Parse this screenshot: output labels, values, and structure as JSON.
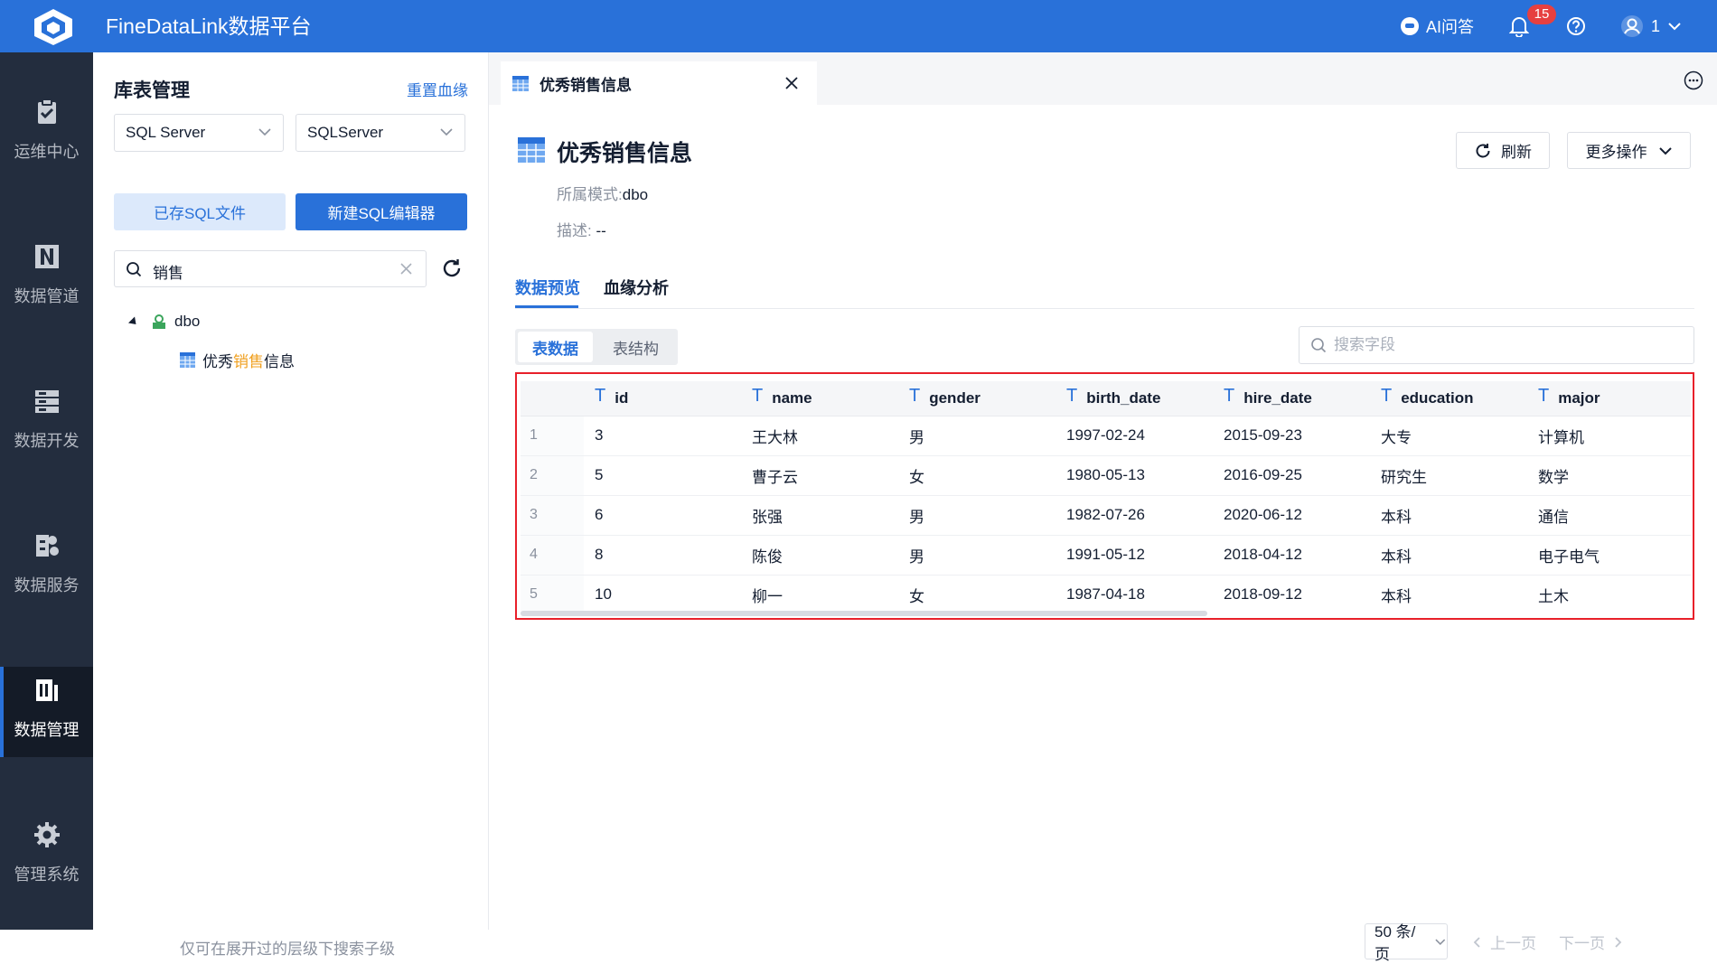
{
  "header": {
    "app_title": "FineDataLink数据平台",
    "ai_label": "AI问答",
    "notification_count": "15",
    "user_name": "1",
    "brand_color": "#2971d9"
  },
  "sidebar": {
    "items": [
      {
        "label": "运维中心",
        "icon": "clipboard-check-icon"
      },
      {
        "label": "数据管道",
        "icon": "pipeline-icon"
      },
      {
        "label": "数据开发",
        "icon": "server-stack-icon"
      },
      {
        "label": "数据服务",
        "icon": "api-service-icon"
      },
      {
        "label": "数据管理",
        "icon": "data-management-icon",
        "active": true
      },
      {
        "label": "管理系统",
        "icon": "gear-icon"
      }
    ]
  },
  "left_panel": {
    "title": "库表管理",
    "reset_link": "重置血缘",
    "db_type": "SQL Server",
    "connection": "SQLServer",
    "saved_sql_button": "已存SQL文件",
    "new_sql_button": "新建SQL编辑器",
    "search_value": "销售",
    "tree": {
      "schema": "dbo",
      "table_prefix": "优秀",
      "table_highlight": "销售",
      "table_suffix": "信息"
    },
    "footer_hint": "仅可在展开过的层级下搜索子级"
  },
  "tab": {
    "label": "优秀销售信息"
  },
  "detail": {
    "title": "优秀销售信息",
    "refresh_button": "刷新",
    "more_button": "更多操作",
    "schema_label": "所属模式:",
    "schema_value": "dbo",
    "desc_label": "描述:",
    "desc_value": "--",
    "tabs": [
      "数据预览",
      "血缘分析"
    ],
    "segments": [
      "表数据",
      "表结构"
    ],
    "field_search_placeholder": "搜索字段"
  },
  "table": {
    "columns": [
      "id",
      "name",
      "gender",
      "birth_date",
      "hire_date",
      "education",
      "major"
    ],
    "rows": [
      {
        "n": "1",
        "cells": [
          "3",
          "王大林",
          "男",
          "1997-02-24",
          "2015-09-23",
          "大专",
          "计算机"
        ]
      },
      {
        "n": "2",
        "cells": [
          "5",
          "曹子云",
          "女",
          "1980-05-13",
          "2016-09-25",
          "研究生",
          "数学"
        ]
      },
      {
        "n": "3",
        "cells": [
          "6",
          "张强",
          "男",
          "1982-07-26",
          "2020-06-12",
          "本科",
          "通信"
        ]
      },
      {
        "n": "4",
        "cells": [
          "8",
          "陈俊",
          "男",
          "1991-05-12",
          "2018-04-12",
          "本科",
          "电子电气"
        ]
      },
      {
        "n": "5",
        "cells": [
          "10",
          "柳一",
          "女",
          "1987-04-18",
          "2018-09-12",
          "本科",
          "土木"
        ]
      }
    ]
  },
  "pager": {
    "page_size": "50 条/页",
    "prev": "上一页",
    "next": "下一页"
  }
}
